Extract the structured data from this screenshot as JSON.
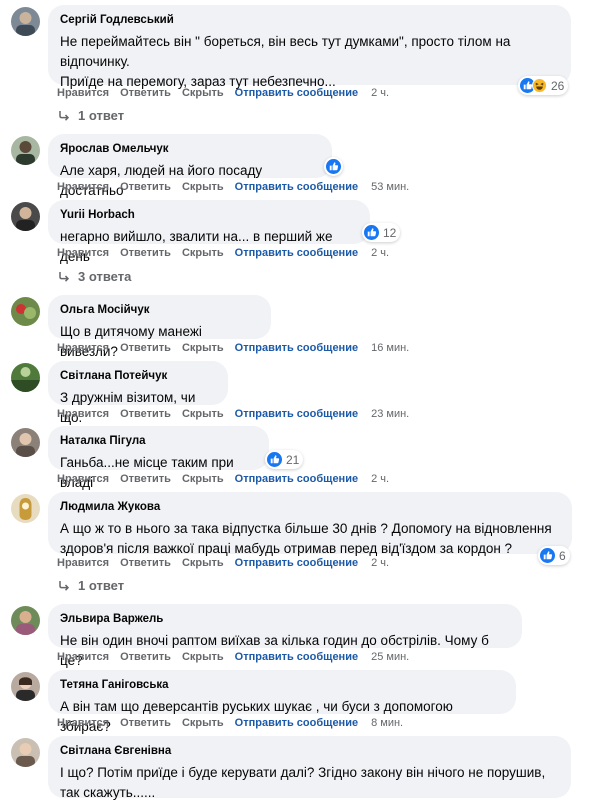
{
  "actions": {
    "like": "Нравится",
    "reply": "Ответить",
    "hide": "Скрыть",
    "message": "Отправить сообщение"
  },
  "colors": {
    "bubble": "#f0f2f5",
    "secondary_text": "#65676b",
    "link": "#1c5aa7",
    "like_blue": "#1877f2",
    "haha_yellow": "#f7b928"
  },
  "comments": [
    {
      "author": "Сергій Годлевський",
      "text": "Не переймайтесь він \" бореться, він весь тут думками\", просто тілом на відпочинку.\nПриїде на перемогу, зараз тут небезпечно...",
      "reactions": {
        "icons": [
          "like-icon",
          "haha-icon"
        ],
        "count": "26"
      },
      "time": "2 ч.",
      "replies": "1 ответ"
    },
    {
      "author": "Ярослав Омельчук",
      "text": "Але харя, людей на його посаду достатньо",
      "reactions": {
        "icons": [
          "like-icon"
        ],
        "count": ""
      },
      "time": "53 мин."
    },
    {
      "author": "Yurii Horbach",
      "text": "негарно вийшло, звалити на... в перший же день",
      "reactions": {
        "icons": [
          "like-icon"
        ],
        "count": "12"
      },
      "time": "2 ч.",
      "replies": "3 ответа"
    },
    {
      "author": "Ольга Мосійчук",
      "text": "Що в дитячому манежі вивезли?",
      "time": "16 мин."
    },
    {
      "author": "Світлана Потейчук",
      "text": "З дружнім візитом, чи що.",
      "time": "23 мин."
    },
    {
      "author": "Наталка Пігула",
      "text": "Ганьба...не місце таким при владі",
      "reactions": {
        "icons": [
          "like-icon"
        ],
        "count": "21"
      },
      "time": "2 ч."
    },
    {
      "author": "Людмила Жукова",
      "text": "А що ж то в нього за така відпустка більше 30 днів ? Допомогу на відновлення здоров'я після важкої праці мабудь отримав перед від'їздом за кордон ?",
      "reactions": {
        "icons": [
          "like-icon"
        ],
        "count": "6"
      },
      "time": "2 ч.",
      "replies": "1 ответ"
    },
    {
      "author": "Эльвира Варжель",
      "text": "Не він один вночі раптом виїхав за кілька годин до обстрілів. Чому б це?",
      "time": "25 мин."
    },
    {
      "author": "Тетяна Ганіговська",
      "text": "А він там що деверсантів руських шукає , чи буси з допомогою збирає?",
      "time": "8 мин."
    },
    {
      "author": "Світлана Євгенівна",
      "text": "І що? Потім приїде і буде керувати далі? Згідно закону він нічого не порушив, так скажуть......"
    }
  ]
}
